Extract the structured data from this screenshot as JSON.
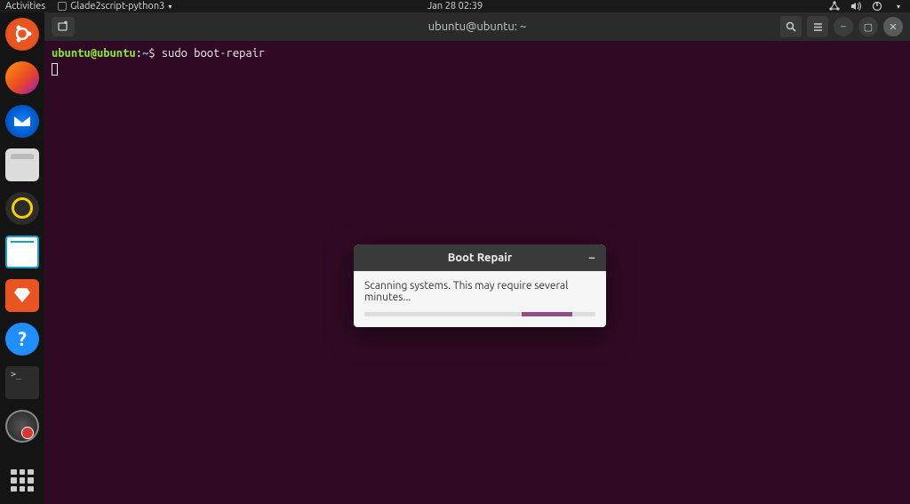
{
  "topbar": {
    "activities": "Activities",
    "app_name": "Glade2script-python3",
    "datetime": "Jan 28  02:39"
  },
  "terminal": {
    "title": "ubuntu@ubuntu: ~",
    "prompt": {
      "user": "ubuntu",
      "at": "@",
      "host": "ubuntu",
      "colon": ":",
      "path": "~",
      "sigil": "$",
      "command": "sudo boot-repair"
    }
  },
  "dialog": {
    "title": "Boot Repair",
    "message": "Scanning systems. This may require several minutes..."
  },
  "dock": {
    "items": [
      {
        "name": "ubuntu-dash"
      },
      {
        "name": "firefox"
      },
      {
        "name": "thunderbird"
      },
      {
        "name": "files"
      },
      {
        "name": "rhythmbox"
      },
      {
        "name": "libreoffice-writer"
      },
      {
        "name": "ubuntu-software"
      },
      {
        "name": "help"
      },
      {
        "name": "terminal"
      },
      {
        "name": "boot-repair"
      }
    ]
  }
}
